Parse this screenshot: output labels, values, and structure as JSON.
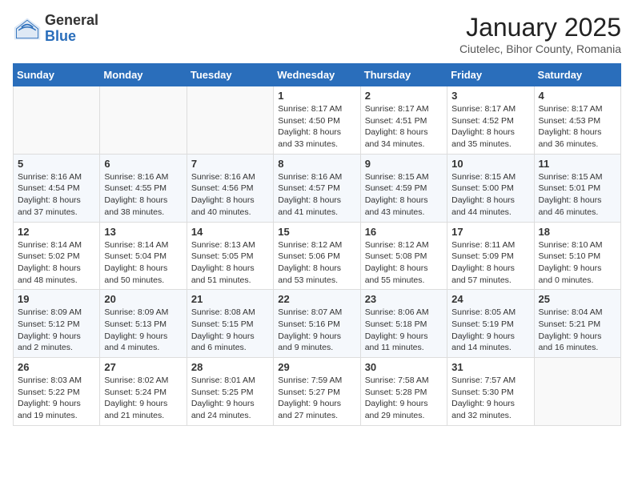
{
  "header": {
    "logo": {
      "general": "General",
      "blue": "Blue"
    },
    "title": "January 2025",
    "subtitle": "Ciutelec, Bihor County, Romania"
  },
  "days_of_week": [
    "Sunday",
    "Monday",
    "Tuesday",
    "Wednesday",
    "Thursday",
    "Friday",
    "Saturday"
  ],
  "weeks": [
    [
      {
        "day": "",
        "info": ""
      },
      {
        "day": "",
        "info": ""
      },
      {
        "day": "",
        "info": ""
      },
      {
        "day": "1",
        "info": "Sunrise: 8:17 AM\nSunset: 4:50 PM\nDaylight: 8 hours and 33 minutes."
      },
      {
        "day": "2",
        "info": "Sunrise: 8:17 AM\nSunset: 4:51 PM\nDaylight: 8 hours and 34 minutes."
      },
      {
        "day": "3",
        "info": "Sunrise: 8:17 AM\nSunset: 4:52 PM\nDaylight: 8 hours and 35 minutes."
      },
      {
        "day": "4",
        "info": "Sunrise: 8:17 AM\nSunset: 4:53 PM\nDaylight: 8 hours and 36 minutes."
      }
    ],
    [
      {
        "day": "5",
        "info": "Sunrise: 8:16 AM\nSunset: 4:54 PM\nDaylight: 8 hours and 37 minutes."
      },
      {
        "day": "6",
        "info": "Sunrise: 8:16 AM\nSunset: 4:55 PM\nDaylight: 8 hours and 38 minutes."
      },
      {
        "day": "7",
        "info": "Sunrise: 8:16 AM\nSunset: 4:56 PM\nDaylight: 8 hours and 40 minutes."
      },
      {
        "day": "8",
        "info": "Sunrise: 8:16 AM\nSunset: 4:57 PM\nDaylight: 8 hours and 41 minutes."
      },
      {
        "day": "9",
        "info": "Sunrise: 8:15 AM\nSunset: 4:59 PM\nDaylight: 8 hours and 43 minutes."
      },
      {
        "day": "10",
        "info": "Sunrise: 8:15 AM\nSunset: 5:00 PM\nDaylight: 8 hours and 44 minutes."
      },
      {
        "day": "11",
        "info": "Sunrise: 8:15 AM\nSunset: 5:01 PM\nDaylight: 8 hours and 46 minutes."
      }
    ],
    [
      {
        "day": "12",
        "info": "Sunrise: 8:14 AM\nSunset: 5:02 PM\nDaylight: 8 hours and 48 minutes."
      },
      {
        "day": "13",
        "info": "Sunrise: 8:14 AM\nSunset: 5:04 PM\nDaylight: 8 hours and 50 minutes."
      },
      {
        "day": "14",
        "info": "Sunrise: 8:13 AM\nSunset: 5:05 PM\nDaylight: 8 hours and 51 minutes."
      },
      {
        "day": "15",
        "info": "Sunrise: 8:12 AM\nSunset: 5:06 PM\nDaylight: 8 hours and 53 minutes."
      },
      {
        "day": "16",
        "info": "Sunrise: 8:12 AM\nSunset: 5:08 PM\nDaylight: 8 hours and 55 minutes."
      },
      {
        "day": "17",
        "info": "Sunrise: 8:11 AM\nSunset: 5:09 PM\nDaylight: 8 hours and 57 minutes."
      },
      {
        "day": "18",
        "info": "Sunrise: 8:10 AM\nSunset: 5:10 PM\nDaylight: 9 hours and 0 minutes."
      }
    ],
    [
      {
        "day": "19",
        "info": "Sunrise: 8:09 AM\nSunset: 5:12 PM\nDaylight: 9 hours and 2 minutes."
      },
      {
        "day": "20",
        "info": "Sunrise: 8:09 AM\nSunset: 5:13 PM\nDaylight: 9 hours and 4 minutes."
      },
      {
        "day": "21",
        "info": "Sunrise: 8:08 AM\nSunset: 5:15 PM\nDaylight: 9 hours and 6 minutes."
      },
      {
        "day": "22",
        "info": "Sunrise: 8:07 AM\nSunset: 5:16 PM\nDaylight: 9 hours and 9 minutes."
      },
      {
        "day": "23",
        "info": "Sunrise: 8:06 AM\nSunset: 5:18 PM\nDaylight: 9 hours and 11 minutes."
      },
      {
        "day": "24",
        "info": "Sunrise: 8:05 AM\nSunset: 5:19 PM\nDaylight: 9 hours and 14 minutes."
      },
      {
        "day": "25",
        "info": "Sunrise: 8:04 AM\nSunset: 5:21 PM\nDaylight: 9 hours and 16 minutes."
      }
    ],
    [
      {
        "day": "26",
        "info": "Sunrise: 8:03 AM\nSunset: 5:22 PM\nDaylight: 9 hours and 19 minutes."
      },
      {
        "day": "27",
        "info": "Sunrise: 8:02 AM\nSunset: 5:24 PM\nDaylight: 9 hours and 21 minutes."
      },
      {
        "day": "28",
        "info": "Sunrise: 8:01 AM\nSunset: 5:25 PM\nDaylight: 9 hours and 24 minutes."
      },
      {
        "day": "29",
        "info": "Sunrise: 7:59 AM\nSunset: 5:27 PM\nDaylight: 9 hours and 27 minutes."
      },
      {
        "day": "30",
        "info": "Sunrise: 7:58 AM\nSunset: 5:28 PM\nDaylight: 9 hours and 29 minutes."
      },
      {
        "day": "31",
        "info": "Sunrise: 7:57 AM\nSunset: 5:30 PM\nDaylight: 9 hours and 32 minutes."
      },
      {
        "day": "",
        "info": ""
      }
    ]
  ]
}
